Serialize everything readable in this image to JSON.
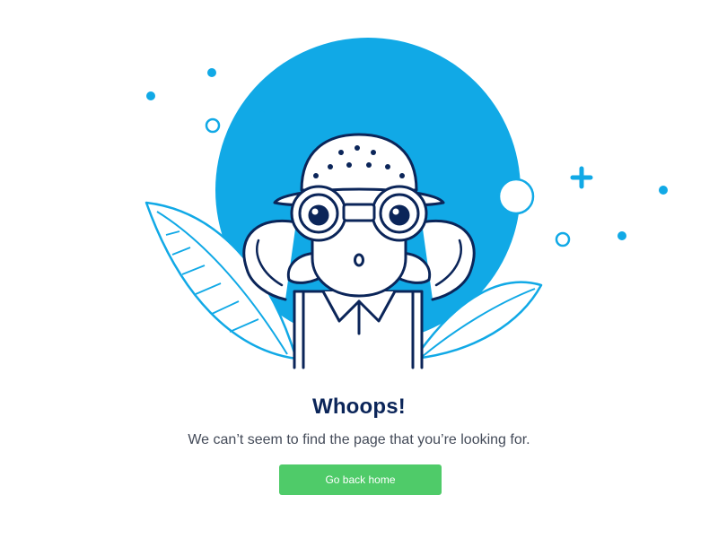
{
  "page": {
    "heading": "Whoops!",
    "message": "We can’t seem to find the page that you’re looking for.",
    "home_button_label": "Go back home"
  },
  "colors": {
    "background": "#ffffff",
    "accent_blue": "#11a9e6",
    "navy": "#0b2559",
    "button_green": "#4fcb69",
    "text_gray": "#444b59"
  },
  "icons": [
    "plus-sparkle-icon",
    "dot-sparkle-icon",
    "ring-sparkle-icon"
  ]
}
